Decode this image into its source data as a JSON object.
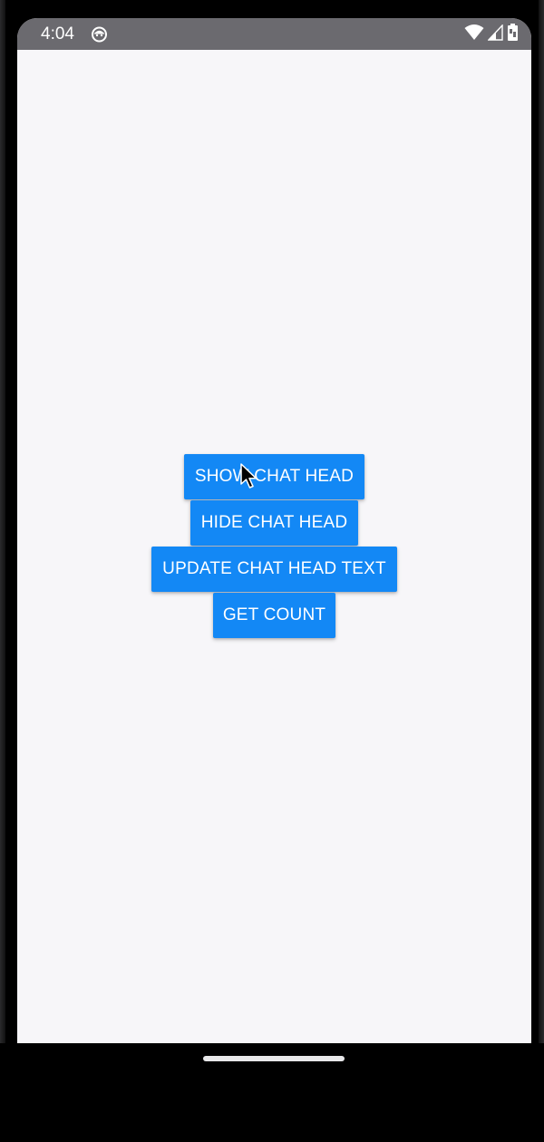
{
  "status_bar": {
    "time": "4:04",
    "app_icon": "android-debug-icon",
    "icons": [
      "wifi-icon",
      "signal-icon",
      "battery-icon"
    ]
  },
  "buttons": {
    "show_chat_head": "SHOW CHAT HEAD",
    "hide_chat_head": "HIDE CHAT HEAD",
    "update_chat_head_text": "UPDATE CHAT HEAD TEXT",
    "get_count": "GET COUNT"
  },
  "colors": {
    "button_bg": "#1388f5",
    "button_text": "#ffffff",
    "screen_bg": "#f7f6f9",
    "status_bar_bg": "#6b6a6f"
  },
  "navigation": {
    "home_indicator": "home-gesture-bar"
  }
}
